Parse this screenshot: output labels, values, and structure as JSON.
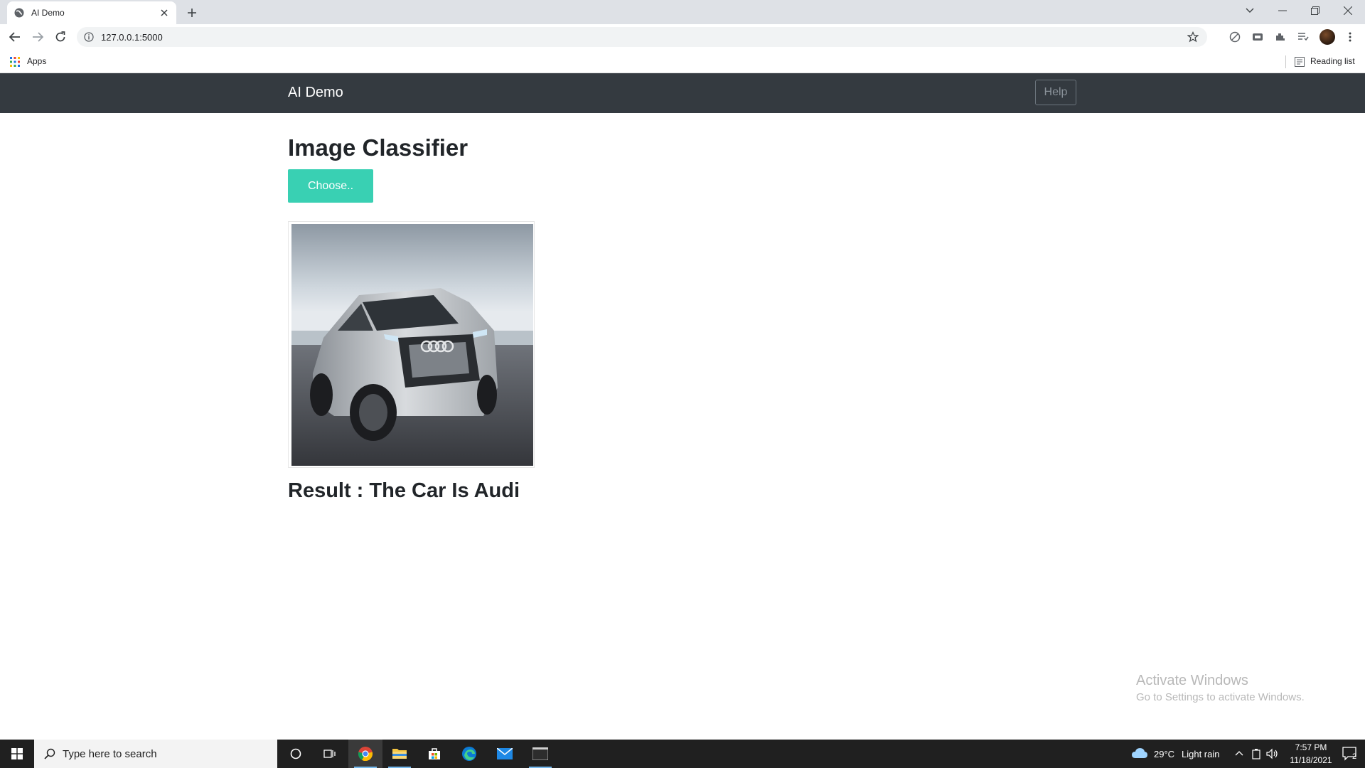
{
  "browser": {
    "tab_title": "AI Demo",
    "url": "127.0.0.1:5000",
    "bookmarks": {
      "apps_label": "Apps",
      "reading_list_label": "Reading list"
    }
  },
  "page": {
    "brand": "AI Demo",
    "help_label": "Help",
    "title": "Image Classifier",
    "choose_label": "Choose..",
    "image_alt": "Uploaded car image",
    "result_text": "Result : The Car Is Audi"
  },
  "watermark": {
    "line1": "Activate Windows",
    "line2": "Go to Settings to activate Windows."
  },
  "taskbar": {
    "search_placeholder": "Type here to search",
    "weather_temp": "29°C",
    "weather_desc": "Light rain",
    "time": "7:57 PM",
    "date": "11/18/2021",
    "notification_count": "2"
  },
  "colors": {
    "navbar_bg": "#343a40",
    "choose_button": "#39d0b3",
    "taskbar_bg": "#202020",
    "tabstrip_bg": "#dee1e6"
  },
  "icons": [
    "globe-icon",
    "close-icon",
    "plus-icon",
    "back-icon",
    "forward-icon",
    "reload-icon",
    "info-icon",
    "star-icon",
    "extension-icon",
    "reading-list-icon",
    "windows-icon",
    "search-icon",
    "cortana-icon",
    "task-view-icon",
    "chrome-icon",
    "folder-icon",
    "store-icon",
    "edge-icon",
    "mail-icon",
    "terminal-icon",
    "cloud-icon"
  ]
}
